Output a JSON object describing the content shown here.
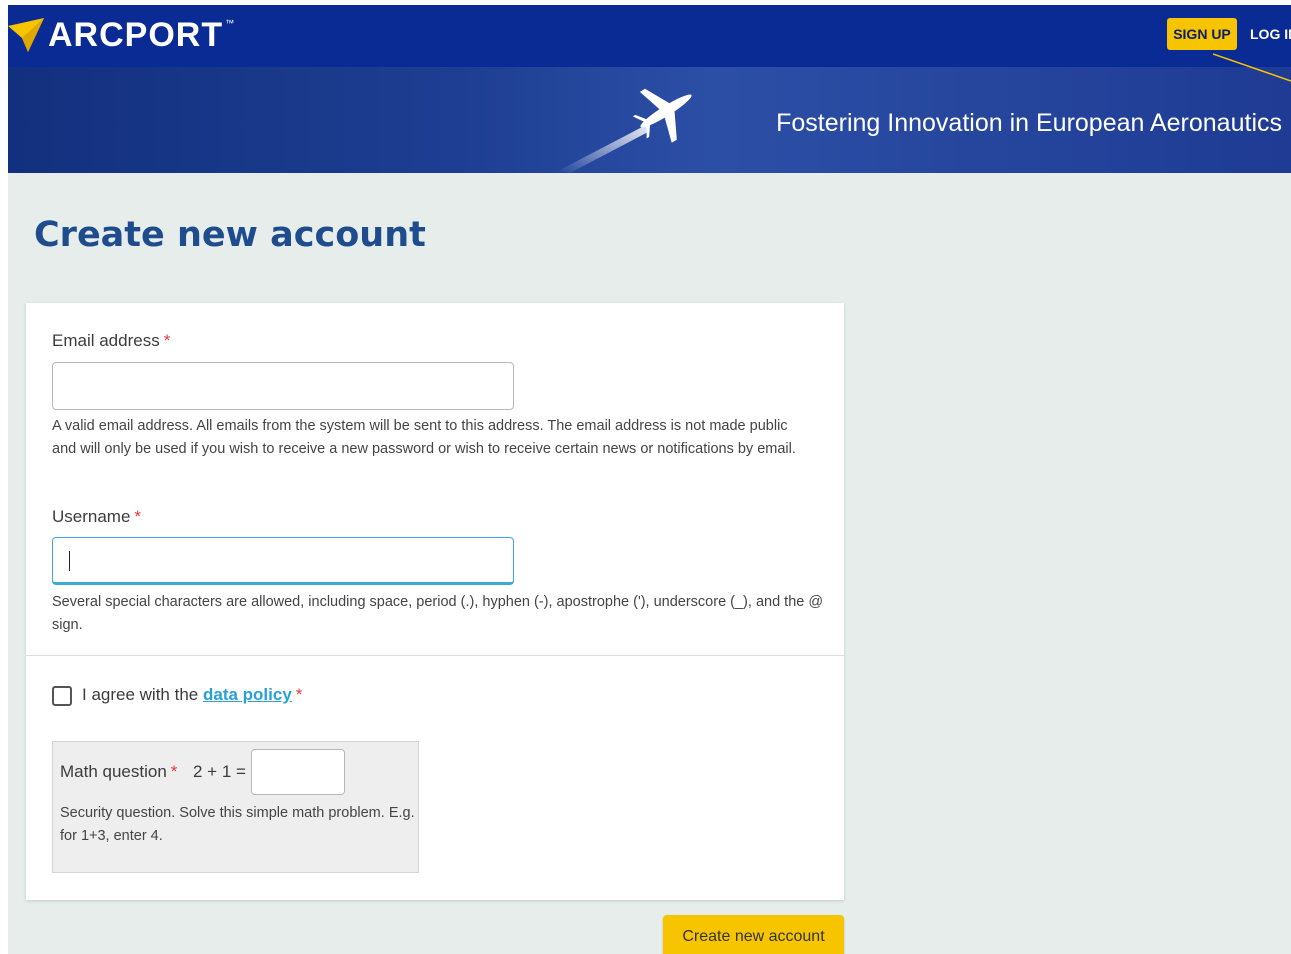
{
  "header": {
    "logo_text": "ARCPORT",
    "logo_tm": "™",
    "signup_label": "SIGN UP",
    "login_label": "LOG IN"
  },
  "banner": {
    "tagline": "Fostering Innovation in European Aeronautics"
  },
  "page_title": "Create new account",
  "form": {
    "email": {
      "label": "Email address",
      "value": "",
      "help": "A valid email address. All emails from the system will be sent to this address. The email address is not made public and will only be used if you wish to receive a new password or wish to receive certain news or notifications by email."
    },
    "username": {
      "label": "Username",
      "value": "",
      "help": "Several special characters are allowed, including space, period (.), hyphen (-), apostrophe ('), underscore (_), and the @ sign."
    },
    "required_mark": "*",
    "agree": {
      "prefix": "I agree with the",
      "link_text": "data policy",
      "checked": false
    },
    "captcha": {
      "label": "Math question",
      "question": "2 + 1 =",
      "value": "",
      "help": "Security question. Solve this simple math problem. E.g. for 1+3, enter 4."
    },
    "submit_label": "Create new account"
  },
  "colors": {
    "nav_bg": "#0a2a94",
    "accent_yellow": "#f7c400",
    "title_blue": "#1e4c8c",
    "link_blue": "#2a9fd8",
    "required_red": "#e0393e",
    "page_bg": "#e6edeb"
  },
  "icons": [
    "logo-arrow-icon",
    "airplane-icon"
  ]
}
